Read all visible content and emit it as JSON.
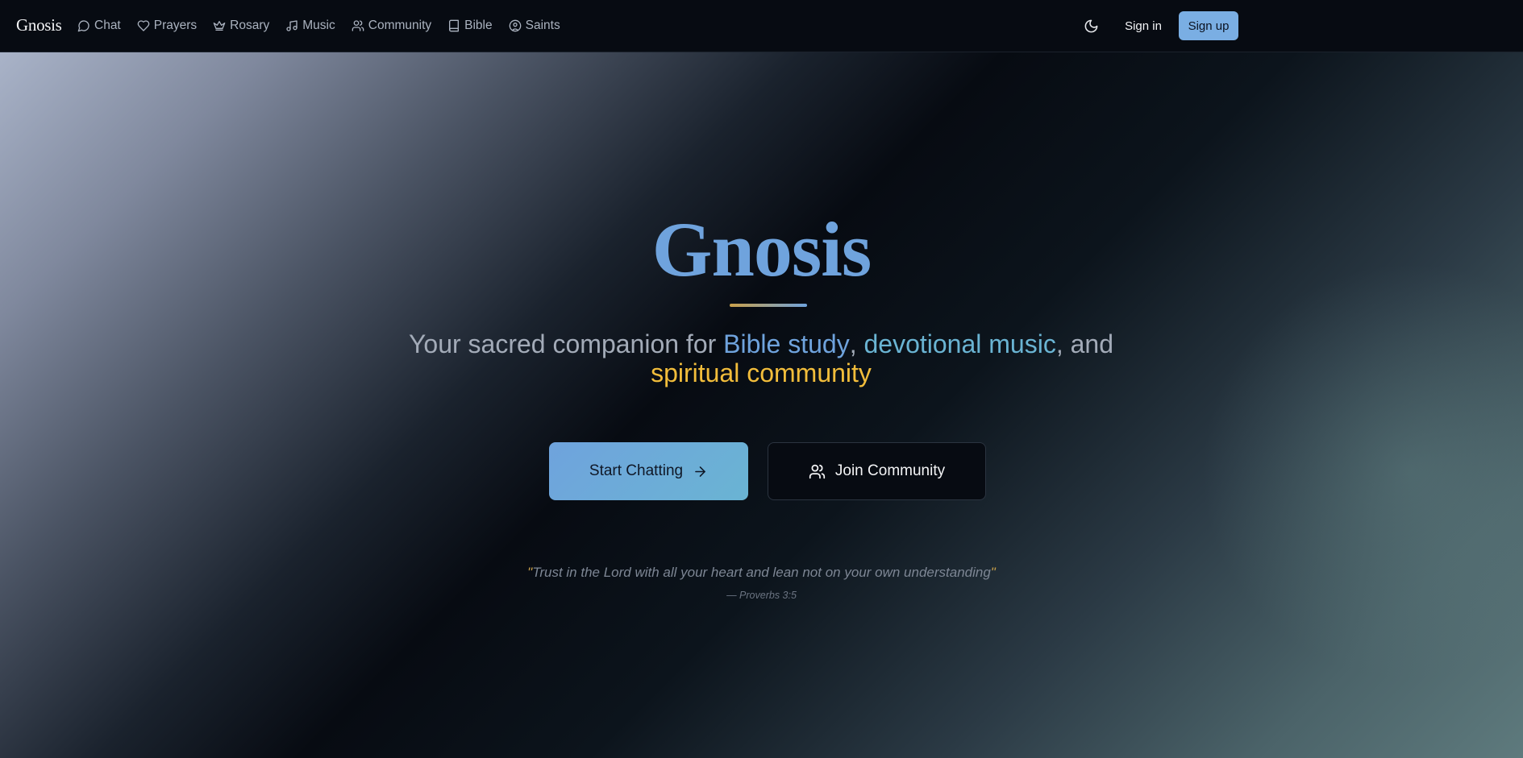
{
  "brand": "Gnosis",
  "nav": [
    {
      "label": "Chat",
      "icon": "message-circle-icon"
    },
    {
      "label": "Prayers",
      "icon": "heart-icon"
    },
    {
      "label": "Rosary",
      "icon": "crown-icon"
    },
    {
      "label": "Music",
      "icon": "music-note-icon"
    },
    {
      "label": "Community",
      "icon": "users-icon"
    },
    {
      "label": "Bible",
      "icon": "book-icon"
    },
    {
      "label": "Saints",
      "icon": "user-circle-icon"
    }
  ],
  "header_actions": {
    "theme_icon": "moon-icon",
    "sign_in": "Sign in",
    "sign_up": "Sign up"
  },
  "hero": {
    "title": "Gnosis",
    "tagline": {
      "prefix": "Your sacred companion for ",
      "highlight_1": "Bible study",
      "sep_1": ", ",
      "highlight_2": "devotional music",
      "sep_2": ", and ",
      "highlight_3": "spiritual community"
    },
    "primary_button": "Start Chatting",
    "secondary_button": "Join Community",
    "quote_open": "\"",
    "quote": "Trust in the Lord with all your heart and lean not on your own understanding",
    "quote_close": "\"",
    "quote_reference": "— Proverbs 3:5"
  },
  "colors": {
    "accent_blue": "#6fa3dd",
    "accent_teal": "#6ab4d3",
    "accent_gold": "#f2bd3b",
    "background": "#070b12"
  }
}
